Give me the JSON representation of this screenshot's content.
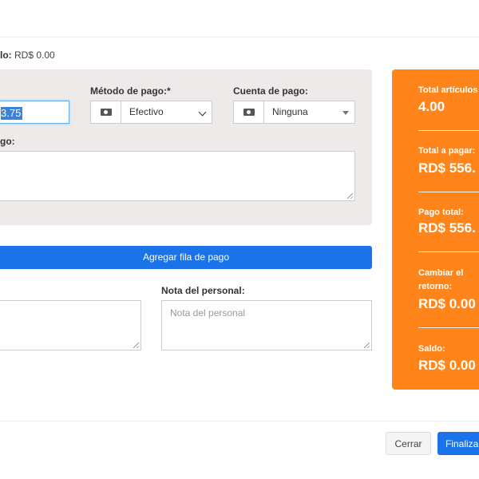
{
  "balance": {
    "label": "lo:",
    "value": "RD$ 0.00"
  },
  "payment": {
    "amount_value": "3.75",
    "method_label": "Método de pago:*",
    "method_value": "Efectivo",
    "account_label": "Cuenta de pago:",
    "account_value": "Ninguna",
    "note_label": "go:"
  },
  "add_row_label": "Agregar fila de pago",
  "staff_note": {
    "label": "Nota del personal:",
    "placeholder": "Nota del personal"
  },
  "summary": {
    "total_items_label": "Total artículos",
    "total_items_value": "4.00",
    "total_payable_label": "Total a pagar:",
    "total_payable_value": "RD$ 556.",
    "total_paid_label": "Pago total:",
    "total_paid_value": "RD$ 556.",
    "change_label_1": "Cambiar el",
    "change_label_2": "retorno:",
    "change_value": "RD$ 0.00",
    "balance_label": "Saldo:",
    "balance_value": "RD$ 0.00"
  },
  "footer": {
    "close_label": "Cerrar",
    "finalize_label": "Finalizar"
  },
  "colors": {
    "summary_bg": "#ff851b",
    "primary": "#1a73e8",
    "panel_bg": "#eeeaea"
  },
  "icons": {
    "payment_method": "money-icon",
    "payment_account": "money-icon"
  }
}
